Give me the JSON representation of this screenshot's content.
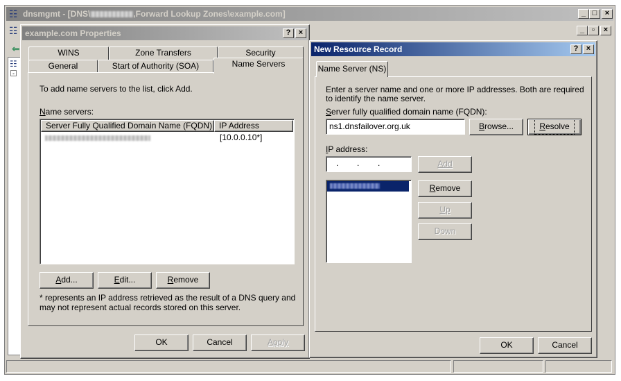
{
  "main_window": {
    "title_prefix": "dnsmgmt - [DNS\\",
    "title_suffix": ",Forward Lookup Zones\\example.com]",
    "min_icon": "_",
    "max_icon": "□",
    "close_icon": "×",
    "inner_min": "_",
    "inner_restore": "▫",
    "inner_close": "×"
  },
  "props_dialog": {
    "title": "example.com Properties",
    "help": "?",
    "close": "×",
    "tabs_back": [
      "WINS",
      "Zone Transfers",
      "Security"
    ],
    "tabs_front": [
      "General",
      "Start of Authority (SOA)",
      "Name Servers"
    ],
    "intro": "To add name servers to the list, click Add.",
    "list_label": "Name servers:",
    "columns": [
      "Server Fully Qualified Domain Name (FQDN)",
      "IP Address"
    ],
    "rows": [
      {
        "ip": "[10.0.0.10*]"
      }
    ],
    "add": "Add...",
    "edit": "Edit...",
    "remove": "Remove",
    "footnote": "* represents an IP address retrieved as the result of a DNS query and may not represent actual records stored on this server.",
    "ok": "OK",
    "cancel": "Cancel",
    "apply": "Apply"
  },
  "rr_dialog": {
    "title": "New Resource Record",
    "help": "?",
    "close": "×",
    "tab": "Name Server (NS)",
    "desc": "Enter a server name and one or more IP addresses. Both are required to identify the name server.",
    "fqdn_label": "Server fully qualified domain name (FQDN):",
    "fqdn_value": "ns1.dnsfailover.org.uk",
    "browse": "Browse...",
    "resolve": "Resolve",
    "ip_label": "IP address:",
    "ip_dots": ".        .        .",
    "add": "Add",
    "remove": "Remove",
    "up": "Up",
    "down": "Down",
    "ok": "OK",
    "cancel": "Cancel"
  },
  "colors": {
    "face": "#d4d0c8",
    "active_title_start": "#0a246a",
    "active_title_end": "#a6caf0",
    "inactive_title_start": "#808080",
    "inactive_title_end": "#c0c0c0"
  }
}
